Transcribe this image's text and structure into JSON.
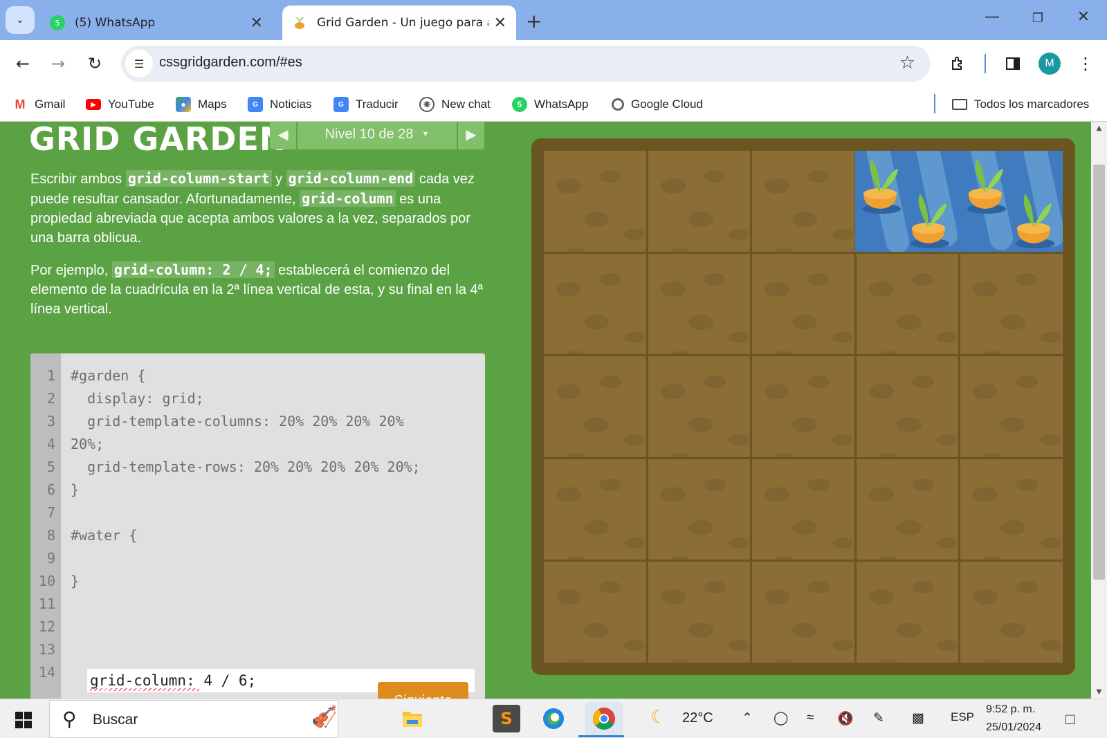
{
  "browser": {
    "tabs": [
      {
        "title": "(5) WhatsApp",
        "favicon": "whatsapp-icon",
        "badge": "5",
        "active": false
      },
      {
        "title": "Grid Garden - Un juego para ap",
        "favicon": "carrot-icon",
        "active": true
      }
    ],
    "url": "cssgridgarden.com/#es",
    "profile_initial": "M",
    "bookmarks": [
      {
        "label": "Gmail",
        "icon": "gmail-icon"
      },
      {
        "label": "YouTube",
        "icon": "youtube-icon"
      },
      {
        "label": "Maps",
        "icon": "maps-icon"
      },
      {
        "label": "Noticias",
        "icon": "news-icon"
      },
      {
        "label": "Traducir",
        "icon": "translate-icon"
      },
      {
        "label": "New chat",
        "icon": "openai-icon"
      },
      {
        "label": "WhatsApp",
        "icon": "whatsapp-icon"
      },
      {
        "label": "Google Cloud",
        "icon": "google-cloud-icon"
      }
    ],
    "all_bookmarks": "Todos los marcadores"
  },
  "game": {
    "logo": "GRID GARDEN",
    "level_label": "Nivel 10 de 28",
    "instructions": {
      "p1": {
        "t1": "Escribir ambos ",
        "c1": "grid-column-start",
        "t2": " y ",
        "c2": "grid-column-end",
        "t3": " cada vez puede resultar cansador. Afortunadamente, ",
        "c3": "grid-column",
        "t4": " es una propiedad abreviada que acepta ambos valores a la vez, separados por una barra oblicua."
      },
      "p2": {
        "t1": "Por ejemplo, ",
        "c1": "grid-column: 2 / 4;",
        "t2": " establecerá el comienzo del elemento de la cuadrícula en la 2ª línea vertical de esta, y su final en la 4ª línea vertical."
      }
    },
    "editor": {
      "line_numbers": [
        "1",
        "2",
        "3",
        "4",
        "5",
        "6",
        "7",
        "8",
        "9",
        "10",
        "11",
        "12",
        "13",
        "14"
      ],
      "lines": [
        "#garden {",
        "  display: grid;",
        "  grid-template-columns: 20% 20% 20% 20%",
        "20%;",
        "  grid-template-rows: 20% 20% 20% 20% 20%;",
        "}",
        "",
        "#water {",
        "",
        "}"
      ],
      "input_value": "grid-column: 4 / 6;"
    },
    "next_button": "Siguiente",
    "garden": {
      "columns": 5,
      "rows": 5,
      "water_column_start": 4,
      "water_column_end": 6
    }
  },
  "taskbar": {
    "search_placeholder": "Buscar",
    "weather": "22°C",
    "language": "ESP",
    "time": "9:52 p. m.",
    "date": "25/01/2024"
  },
  "colors": {
    "page_bg": "#5aa244",
    "soil": "#8a6e36",
    "frame": "#6b5521",
    "water": "#3f7bbe",
    "carrot": "#f0a030",
    "leaf": "#7cc142",
    "next_button": "#dd8b1c",
    "tab_strip": "#8ab0ec"
  }
}
